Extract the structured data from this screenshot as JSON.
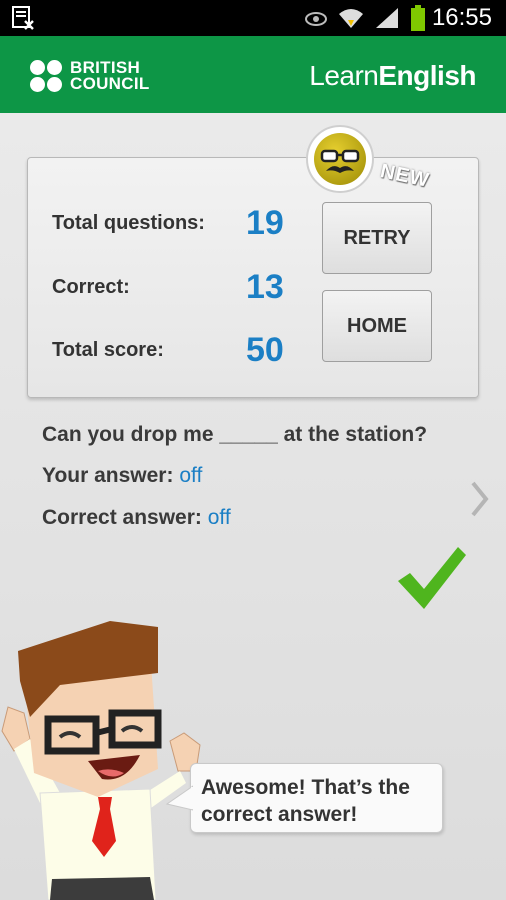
{
  "status_bar": {
    "time": "16:55"
  },
  "header": {
    "brand_line1": "BRITISH",
    "brand_line2": "COUNCIL",
    "app_name_part1": "Learn",
    "app_name_part2": "English",
    "brand_color": "#0d9646"
  },
  "score": {
    "stats": [
      {
        "label": "Total questions:",
        "value": "19"
      },
      {
        "label": "Correct:",
        "value": "13"
      },
      {
        "label": "Total score:",
        "value": "50"
      }
    ],
    "retry_label": "RETRY",
    "home_label": "HOME",
    "badge_tag": "NEW"
  },
  "question": {
    "text": "Can you drop me _____ at the station?",
    "your_answer_label": "Your answer:",
    "your_answer_value": "off",
    "correct_answer_label": "Correct answer:",
    "correct_answer_value": "off"
  },
  "feedback": {
    "message_line1": "Awesome!  That’s the",
    "message_line2": "correct answer!",
    "check_color": "#4fb51e"
  },
  "accent_color": "#1b7fc5"
}
